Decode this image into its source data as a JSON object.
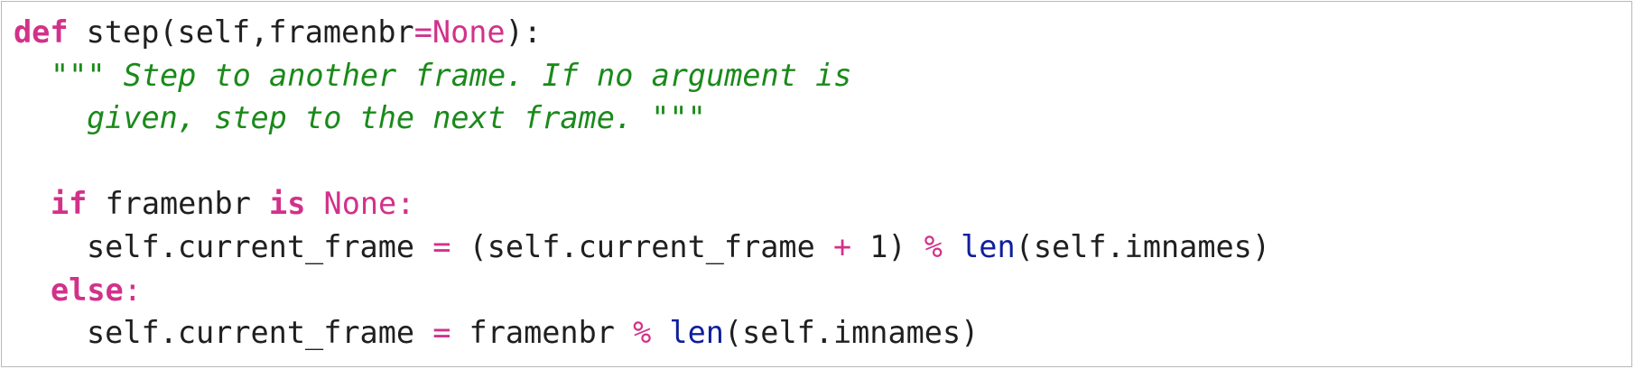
{
  "code": {
    "language": "python",
    "colors": {
      "keyword": "#d2318a",
      "operator": "#d2318a",
      "builtin": "#0f1f9c",
      "docstring": "#1a8a1a",
      "text": "#1f1f1f",
      "border": "#b9b9b9"
    },
    "line1": {
      "kw_def": "def",
      "name_sig": " step(self,framenbr",
      "op_eq": "=",
      "const_none": "None",
      "close": "):"
    },
    "line2": {
      "doc": "\"\"\" Step to another frame. If no argument is"
    },
    "line3": {
      "doc": "given, step to the next frame. \"\"\""
    },
    "line5": {
      "kw_if": "if",
      "var": " framenbr ",
      "kw_is": "is",
      "space": " ",
      "const_none": "None",
      "colon": ":"
    },
    "line6": {
      "lhs": "self.current_frame ",
      "op_eq": "=",
      "paren_expr": " (self.current_frame ",
      "op_plus": "+",
      "num": " 1) ",
      "op_mod": "%",
      "space": " ",
      "fn_len": "len",
      "arg": "(self.imnames)"
    },
    "line7": {
      "kw_else": "else",
      "colon": ":"
    },
    "line8": {
      "lhs": "self.current_frame ",
      "op_eq": "=",
      "var": " framenbr ",
      "op_mod": "%",
      "space": " ",
      "fn_len": "len",
      "arg": "(self.imnames)"
    }
  }
}
